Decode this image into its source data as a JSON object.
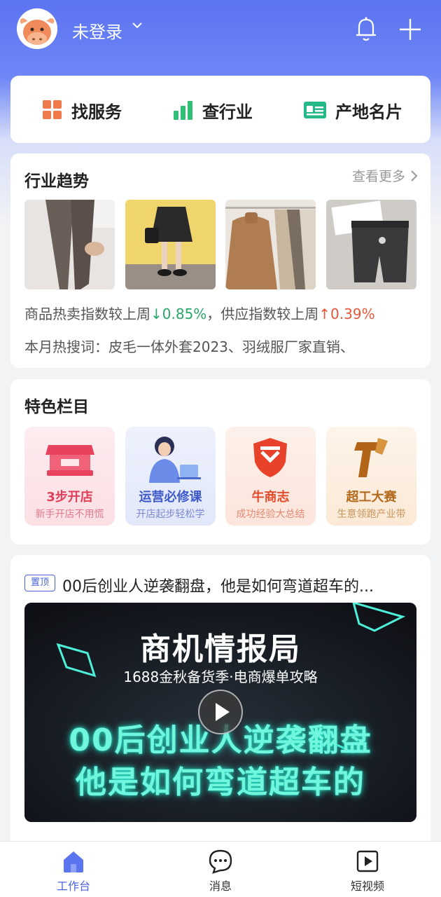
{
  "header": {
    "login_label": "未登录",
    "chevron": "⌄",
    "icons": [
      "cow-avatar-icon",
      "bell-icon",
      "plus-icon"
    ]
  },
  "quick_nav": [
    {
      "label": "找服务",
      "icon": "grid-icon",
      "color": "#f07a4a"
    },
    {
      "label": "查行业",
      "icon": "bar-chart-icon",
      "color": "#2fbf77"
    },
    {
      "label": "产地名片",
      "icon": "id-card-icon",
      "color": "#25b98a"
    }
  ],
  "trend": {
    "title": "行业趋势",
    "more_label": "查看更多",
    "stats": {
      "prefix": "商品热卖指数较上周",
      "sales_change": "↓0.85%",
      "middle": "，供应指数较上周",
      "supply_change": "↑0.39%"
    },
    "hot_searches": "本月热搜词：皮毛一体外套2023、羽绒服厂家直销、"
  },
  "features": {
    "title": "特色栏目",
    "items": [
      {
        "title": "3步开店",
        "subtitle": "新手开店不用慌",
        "icon": "shop-icon",
        "title_color": "#e0405a",
        "sub_color": "#e07a8a",
        "bg": "#fde7ea"
      },
      {
        "title": "运营必修课",
        "subtitle": "开店起步轻松学",
        "icon": "teacher-icon",
        "title_color": "#3d59c9",
        "sub_color": "#7b8bd1",
        "bg": "#e8ecfb"
      },
      {
        "title": "牛商志",
        "subtitle": "成功经验大总结",
        "icon": "shield-icon",
        "title_color": "#e24c2c",
        "sub_color": "#e38a72",
        "bg": "#fdebe4"
      },
      {
        "title": "超工大赛",
        "subtitle": "生意领跑产业带",
        "icon": "t-logo-icon",
        "title_color": "#b46a1c",
        "sub_color": "#c7955a",
        "bg": "#fdf0e2"
      }
    ]
  },
  "news": {
    "pin_label": "置顶",
    "title": "00后创业人逆袭翻盘，他是如何弯道超车的...",
    "video": {
      "headline": "商机情报局",
      "subheadline": "1688金秋备货季·电商爆单攻略",
      "line1": "00后创业人逆袭翻盘",
      "line2": "他是如何弯道超车的"
    }
  },
  "tabbar": [
    {
      "label": "工作台",
      "icon": "home-icon",
      "active": true
    },
    {
      "label": "消息",
      "icon": "message-icon",
      "active": false
    },
    {
      "label": "短视频",
      "icon": "video-icon",
      "active": false
    }
  ],
  "colors": {
    "accent": "#4b63e0",
    "header_bg": "#5b74f0"
  }
}
